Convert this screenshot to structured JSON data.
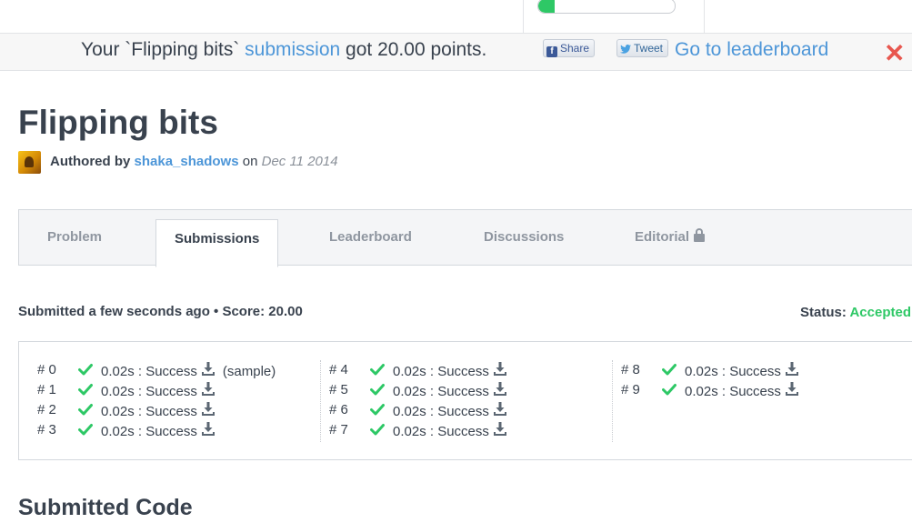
{
  "progress": {
    "fraction": 0.12,
    "color": "#2ec866"
  },
  "notification": {
    "prefix": "Your `Flipping bits`",
    "link_text": "submission",
    "suffix": "got 20.00 points.",
    "share_label": "Share",
    "share_icon_glyph": "f",
    "tweet_label": "Tweet",
    "leaderboard_link": "Go to leaderboard",
    "close_glyph": "✕"
  },
  "challenge": {
    "title": "Flipping bits",
    "authored_by": "Authored by",
    "author": "shaka_shadows",
    "on": "on",
    "date": "Dec 11 2014"
  },
  "tabs": [
    {
      "label": "Problem",
      "active": false
    },
    {
      "label": "Submissions",
      "active": true
    },
    {
      "label": "Leaderboard",
      "active": false
    },
    {
      "label": "Discussions",
      "active": false
    },
    {
      "label": "Editorial",
      "active": false,
      "locked": true
    }
  ],
  "submission": {
    "summary": "Submitted a few seconds ago • Score: 20.00",
    "status_label": "Status:",
    "status_value": "Accepted"
  },
  "tests": [
    {
      "num": "# 0",
      "result": "0.02s : Success",
      "note": "(sample)"
    },
    {
      "num": "# 1",
      "result": "0.02s : Success",
      "note": ""
    },
    {
      "num": "# 2",
      "result": "0.02s : Success",
      "note": ""
    },
    {
      "num": "# 3",
      "result": "0.02s : Success",
      "note": ""
    },
    {
      "num": "# 4",
      "result": "0.02s : Success",
      "note": ""
    },
    {
      "num": "# 5",
      "result": "0.02s : Success",
      "note": ""
    },
    {
      "num": "# 6",
      "result": "0.02s : Success",
      "note": ""
    },
    {
      "num": "# 7",
      "result": "0.02s : Success",
      "note": ""
    },
    {
      "num": "# 8",
      "result": "0.02s : Success",
      "note": ""
    },
    {
      "num": "# 9",
      "result": "0.02s : Success",
      "note": ""
    }
  ],
  "code_section": {
    "title": "Submitted Code"
  },
  "colors": {
    "accent": "#4d96d8",
    "success": "#2ec866",
    "close": "#e8574f",
    "text": "#39424e"
  }
}
